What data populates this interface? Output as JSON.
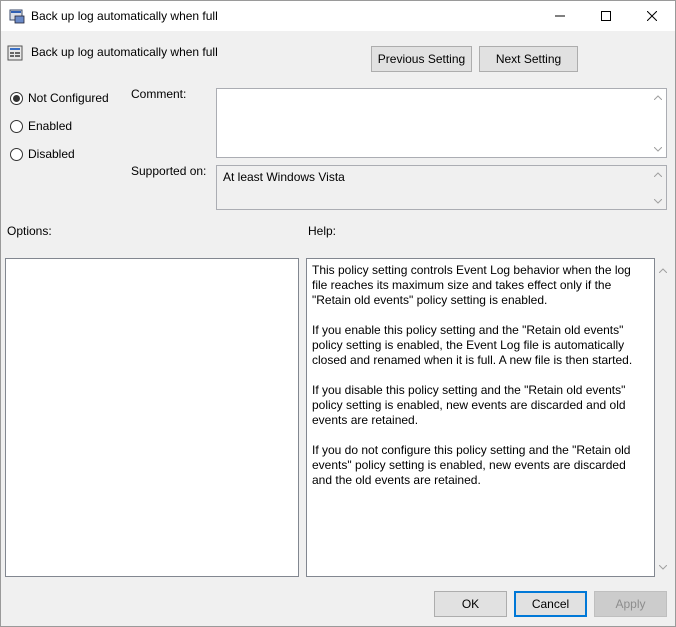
{
  "window": {
    "title": "Back up log automatically when full"
  },
  "header": {
    "title": "Back up log automatically when full",
    "previous_label": "Previous Setting",
    "next_label": "Next Setting"
  },
  "state": {
    "options": [
      {
        "label": "Not Configured",
        "selected": true
      },
      {
        "label": "Enabled",
        "selected": false
      },
      {
        "label": "Disabled",
        "selected": false
      }
    ]
  },
  "comment": {
    "label": "Comment:",
    "value": ""
  },
  "supported": {
    "label": "Supported on:",
    "value": "At least Windows Vista"
  },
  "options_panel": {
    "label": "Options:"
  },
  "help_panel": {
    "label": "Help:",
    "paragraphs": [
      "This policy setting controls Event Log behavior when the log file reaches its maximum size and takes effect only if the \"Retain old events\" policy setting is enabled.",
      "If you enable this policy setting and the \"Retain old events\" policy setting is enabled, the Event Log file is automatically closed and renamed when it is full. A new file is then started.",
      "If you disable this policy setting and the \"Retain old events\" policy setting is enabled, new events are discarded and old events are retained.",
      "If you do not configure this policy setting and the \"Retain old events\" policy setting is enabled, new events are discarded and the old events are retained."
    ]
  },
  "footer": {
    "ok_label": "OK",
    "cancel_label": "Cancel",
    "apply_label": "Apply"
  },
  "colors": {
    "accent": "#0078d7",
    "background": "#f0f0f0"
  }
}
